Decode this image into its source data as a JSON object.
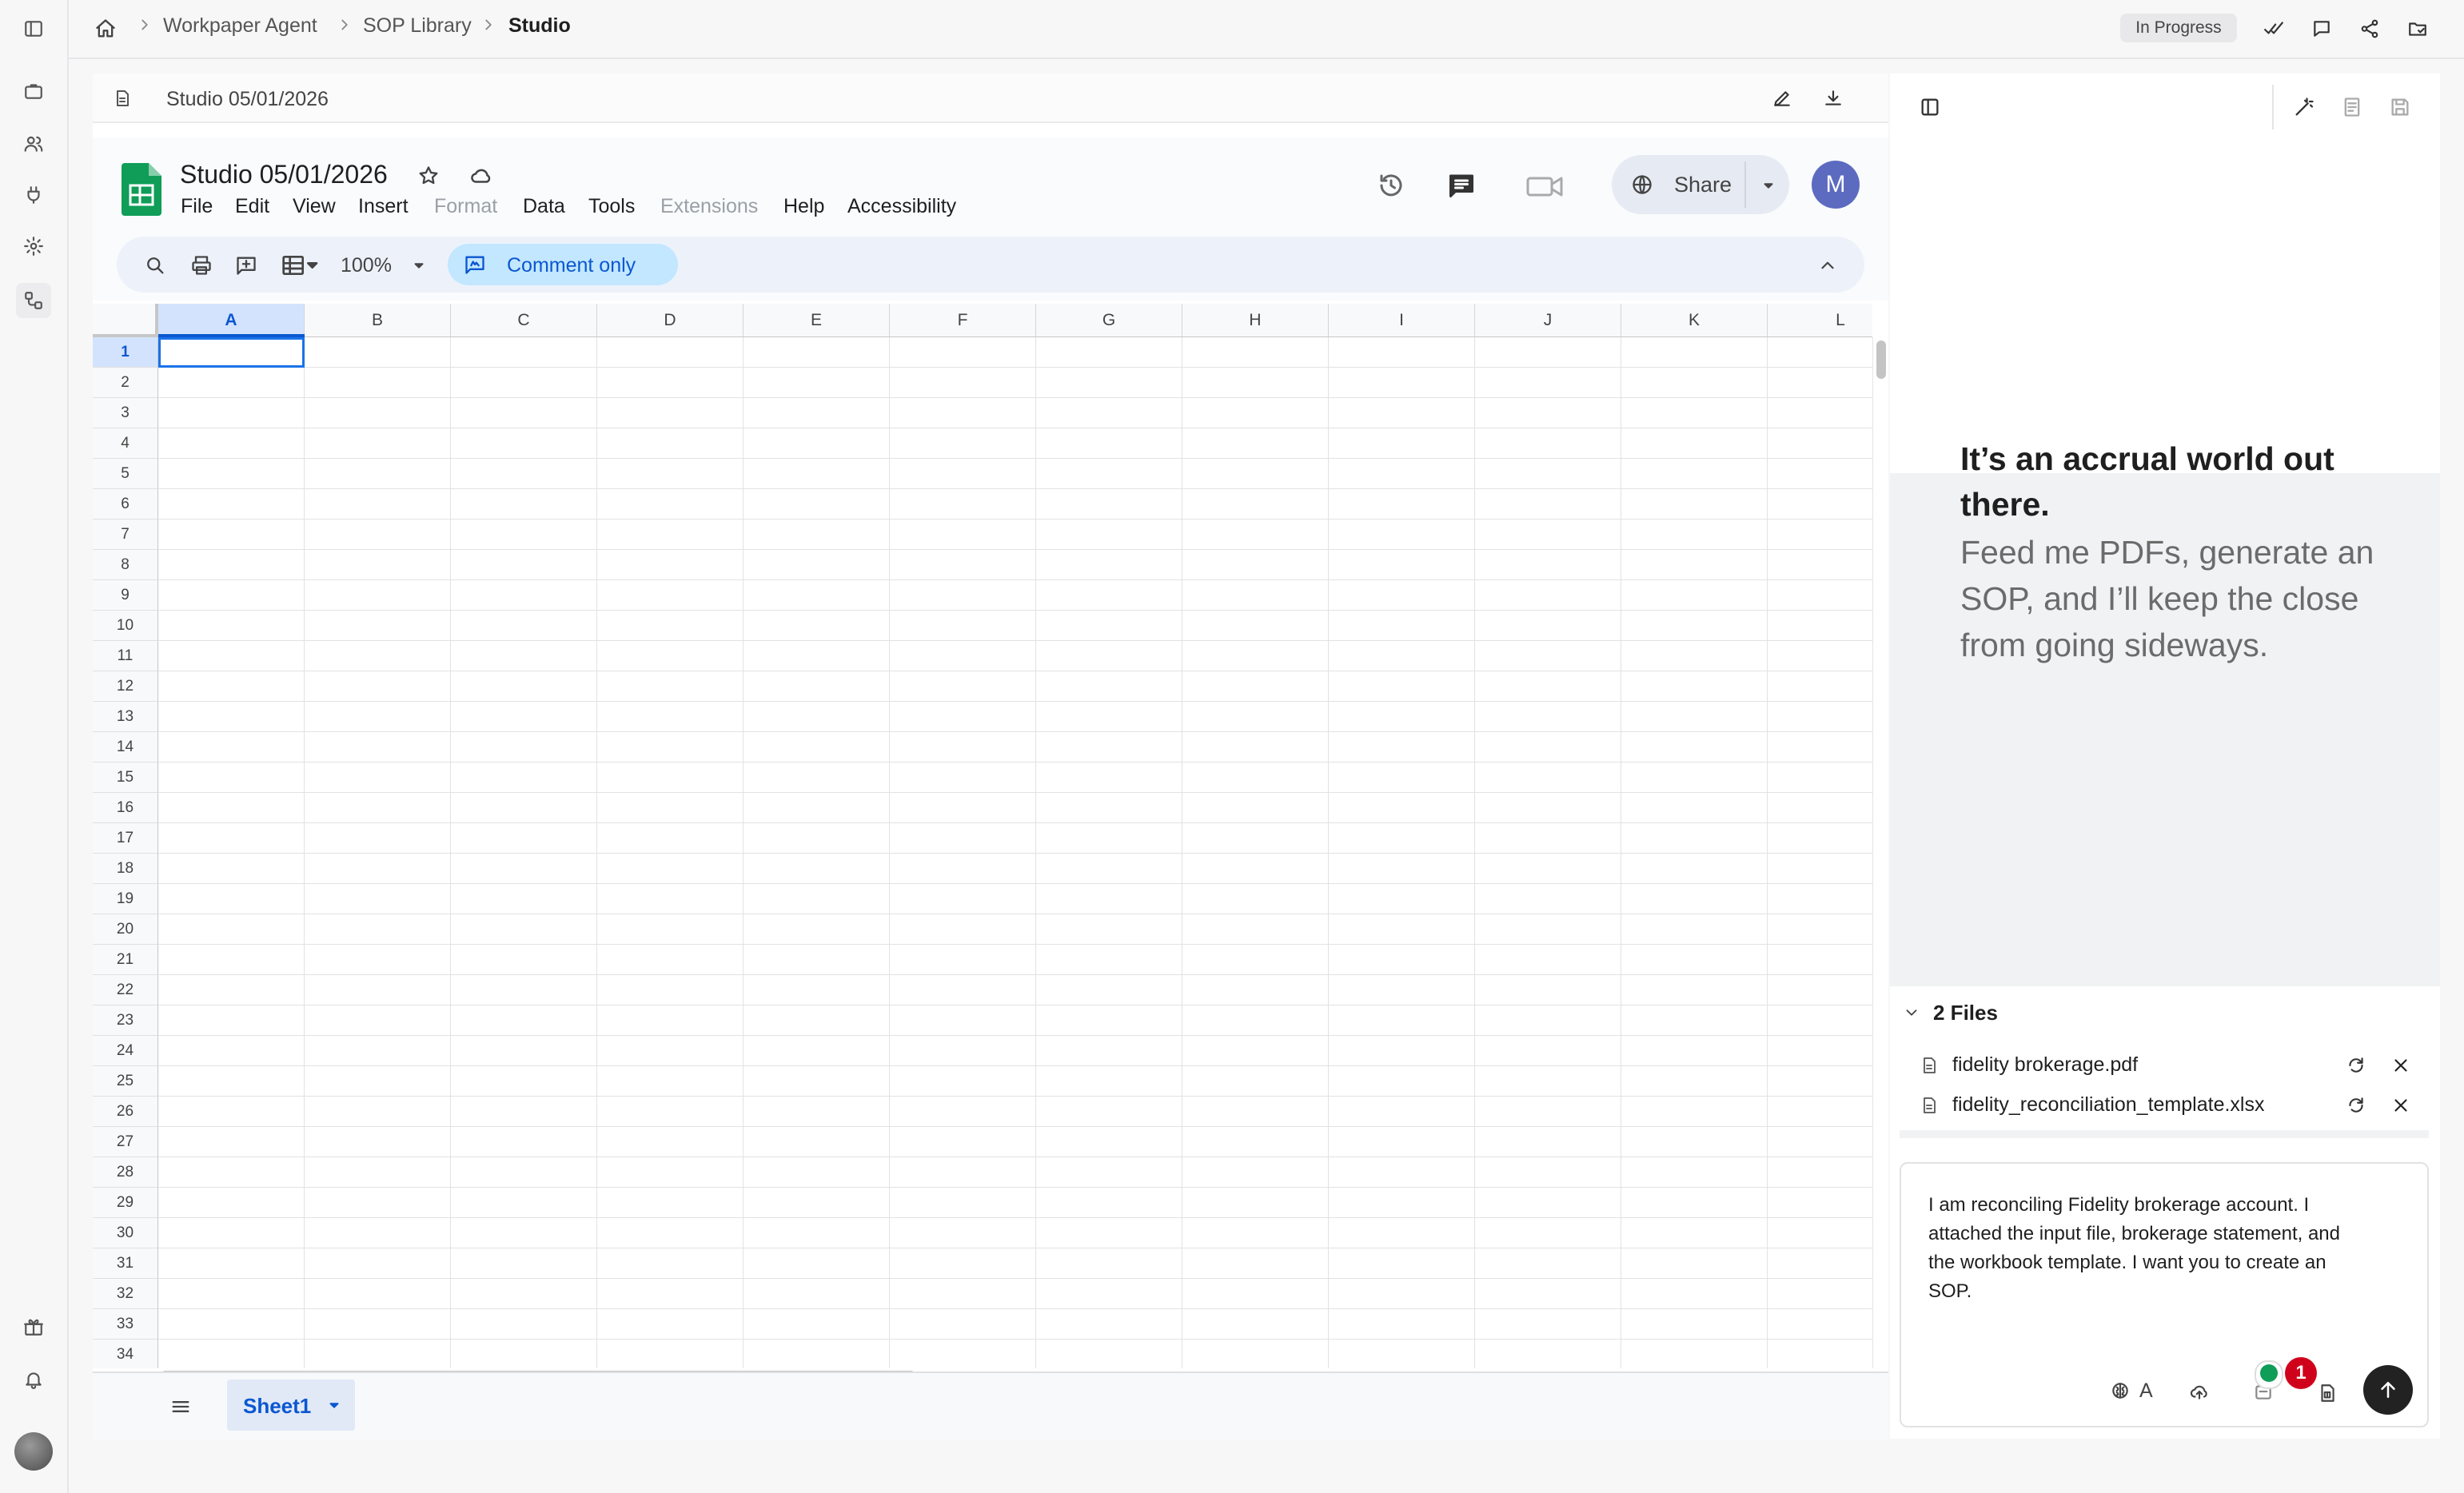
{
  "breadcrumb": {
    "items": [
      "Workpaper Agent",
      "SOP Library",
      "Studio"
    ]
  },
  "status_badge": "In Progress",
  "document": {
    "header_title": "Studio 05/01/2026"
  },
  "sheets": {
    "title": "Studio 05/01/2026",
    "menu": [
      "File",
      "Edit",
      "View",
      "Insert",
      "Format",
      "Data",
      "Tools",
      "Extensions",
      "Help",
      "Accessibility"
    ],
    "zoom": "100%",
    "mode_label": "Comment only",
    "share_label": "Share",
    "avatar_initial": "M",
    "columns": [
      "A",
      "B",
      "C",
      "D",
      "E",
      "F",
      "G",
      "H",
      "I",
      "J",
      "K",
      "L"
    ],
    "rows": [
      "1",
      "2",
      "3",
      "4",
      "5",
      "6",
      "7",
      "8",
      "9",
      "10",
      "11",
      "12",
      "13",
      "14",
      "15",
      "16",
      "17",
      "18",
      "19",
      "20",
      "21",
      "22",
      "23",
      "24",
      "25",
      "26",
      "27",
      "28",
      "29",
      "30",
      "31",
      "32",
      "33",
      "34"
    ],
    "active_cell": "A1",
    "sheet_tab": "Sheet1"
  },
  "assistant": {
    "hero_bold": "It’s an accrual world out there.",
    "hero_body": "Feed me PDFs, generate an SOP, and I’ll keep the close from going sideways.",
    "files_header": "2 Files",
    "files": [
      {
        "name": "fidelity brokerage.pdf"
      },
      {
        "name": "fidelity_reconciliation_template.xlsx"
      }
    ],
    "composer_text": "I am reconciling Fidelity brokerage account. I attached the input file, brokerage statement, and the workbook template. I want you to create an SOP.",
    "composer_mode": "A",
    "notification_count": "1"
  },
  "colors": {
    "sheets_green": "#0f9d58",
    "comment_pill": "#c2e7ff",
    "avatar": "#5c6bc0",
    "badge_red": "#d0021b"
  }
}
